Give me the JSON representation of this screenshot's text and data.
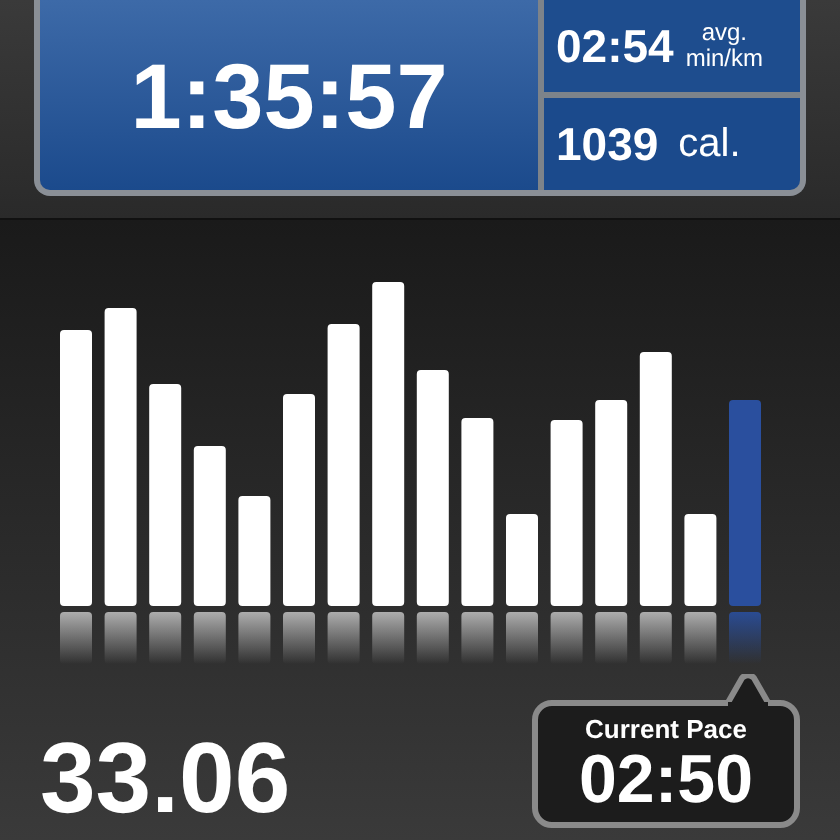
{
  "stats": {
    "elapsed_time": "1:35:57",
    "avg_pace": {
      "value": "02:54",
      "label": "avg.",
      "unit": "min/km"
    },
    "calories": {
      "value": "1039",
      "unit": "cal."
    }
  },
  "distance": "33.06",
  "current_pace": {
    "label": "Current Pace",
    "value": "02:50"
  }
}
